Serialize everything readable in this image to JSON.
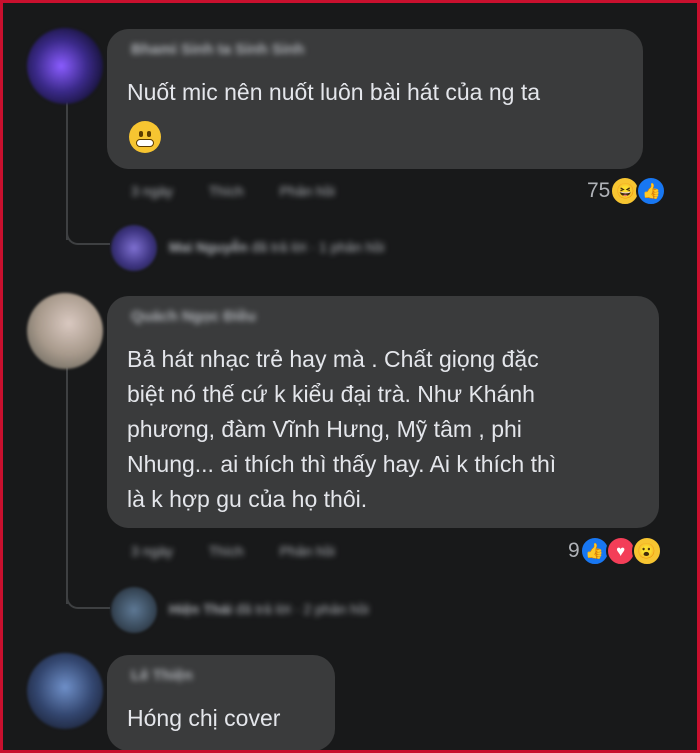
{
  "comments": [
    {
      "author": "Bhami Sinh ta Sinh Sinh",
      "text": "Nuốt mic nên nuốt luôn bài hát của ng ta",
      "emoji": "grimacing-face",
      "meta": {
        "time": "3 ngày",
        "like": "Thích",
        "reply": "Phản hồi"
      },
      "reaction_count": "75",
      "reactions": [
        "haha",
        "like"
      ],
      "reply_summary": {
        "name": "Mai Nguyễn",
        "action": "đã trả lời",
        "time": "1 phản hồi"
      }
    },
    {
      "author": "Quách Ngọc Điều",
      "text": "Bả hát nhạc trẻ hay mà . Chất giọng đặc\nbiệt nó thế cứ k kiểu đại trà. Như Khánh\nphương, đàm Vĩnh Hưng, Mỹ tâm , phi\nNhung... ai thích thì thấy hay. Ai k thích thì\nlà k hợp gu của họ thôi.",
      "meta": {
        "time": "3 ngày",
        "like": "Thích",
        "reply": "Phản hồi"
      },
      "reaction_count": "9",
      "reactions": [
        "like",
        "love",
        "wow"
      ],
      "reply_summary": {
        "name": "Hiện Thái",
        "action": "đã trả lời",
        "time": "2 phản hồi"
      }
    },
    {
      "author": "Lê Thiện",
      "text": "Hóng chị cover"
    }
  ],
  "icons": {
    "like": "thumbs-up",
    "love": "heart",
    "haha": "laughing-face",
    "wow": "surprised-face"
  },
  "colors": {
    "frame_border": "#c8102e",
    "background": "#18191a",
    "bubble": "#3a3b3c",
    "like": "#1877f2",
    "love": "#f33e58"
  }
}
